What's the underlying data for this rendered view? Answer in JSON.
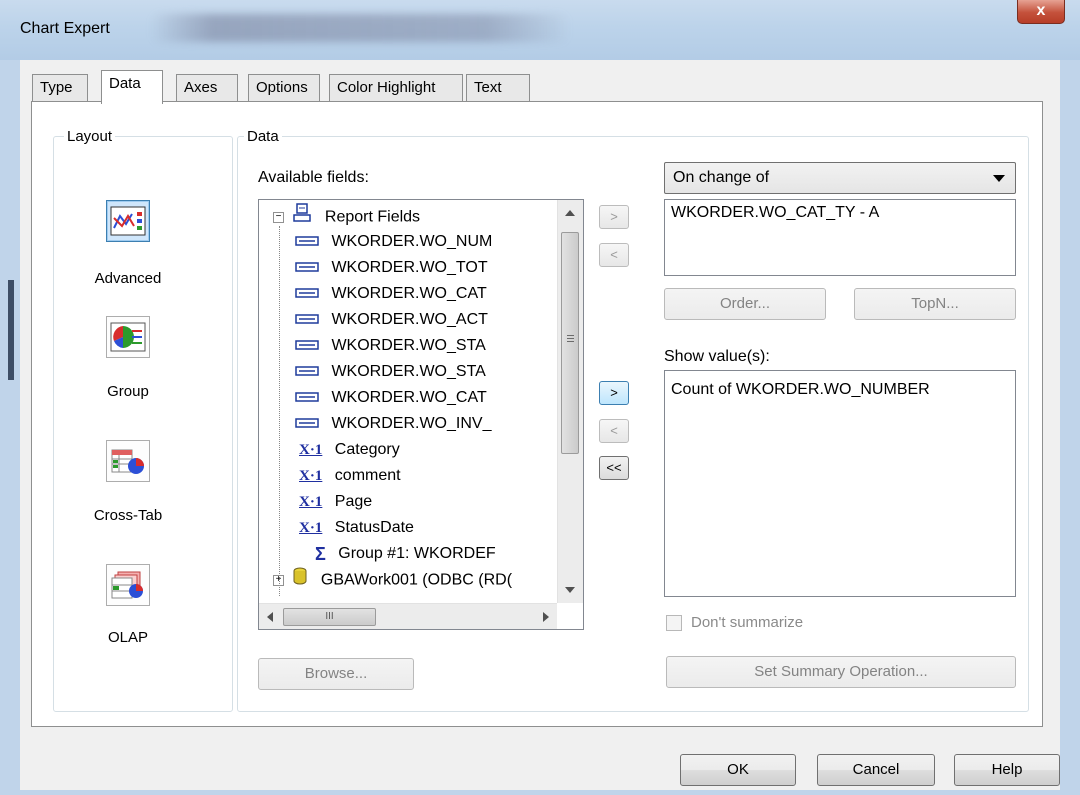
{
  "window": {
    "title": "Chart Expert",
    "close_glyph": "x"
  },
  "tabs": [
    {
      "label": "Type"
    },
    {
      "label": "Data"
    },
    {
      "label": "Axes"
    },
    {
      "label": "Options"
    },
    {
      "label": "Color Highlight"
    },
    {
      "label": "Text"
    }
  ],
  "active_tab": "Data",
  "layout_group": {
    "label": "Layout",
    "items": [
      {
        "label": "Advanced",
        "icon": "advanced-chart-icon",
        "selected": true
      },
      {
        "label": "Group",
        "icon": "group-chart-icon",
        "selected": false
      },
      {
        "label": "Cross-Tab",
        "icon": "crosstab-chart-icon",
        "selected": false
      },
      {
        "label": "OLAP",
        "icon": "olap-chart-icon",
        "selected": false
      }
    ]
  },
  "data_group": {
    "label": "Data",
    "available_fields_label": "Available fields:",
    "tree": [
      {
        "label": "Report Fields",
        "icon": "report-fields-icon",
        "expander": "minus"
      },
      {
        "label": "WKORDER.WO_NUM",
        "icon": "database-field-icon"
      },
      {
        "label": "WKORDER.WO_TOT",
        "icon": "database-field-icon"
      },
      {
        "label": "WKORDER.WO_CAT",
        "icon": "database-field-icon"
      },
      {
        "label": "WKORDER.WO_ACT",
        "icon": "database-field-icon"
      },
      {
        "label": "WKORDER.WO_STA",
        "icon": "database-field-icon"
      },
      {
        "label": "WKORDER.WO_STA",
        "icon": "database-field-icon"
      },
      {
        "label": "WKORDER.WO_CAT",
        "icon": "database-field-icon"
      },
      {
        "label": "WKORDER.WO_INV_",
        "icon": "database-field-icon"
      },
      {
        "label": "Category",
        "icon": "formula-field-icon"
      },
      {
        "label": "comment",
        "icon": "formula-field-icon"
      },
      {
        "label": "Page",
        "icon": "formula-field-icon"
      },
      {
        "label": "StatusDate",
        "icon": "formula-field-icon"
      },
      {
        "label": "Group #1: WKORDEF",
        "icon": "summary-sigma-icon"
      },
      {
        "label": "GBAWork001 (ODBC (RD(",
        "icon": "database-icon",
        "expander": "plus"
      }
    ],
    "hscroll_thumb_glyph": "III",
    "on_change_select": {
      "value": "On change of"
    },
    "on_change_fields": [
      "WKORDER.WO_CAT_TY - A"
    ],
    "order_button": "Order...",
    "topn_button": "TopN...",
    "show_values_label": "Show value(s):",
    "show_values": [
      "Count of WKORDER.WO_NUMBER"
    ],
    "dont_summarize_label": "Don't summarize",
    "dont_summarize_checked": false,
    "browse_button": "Browse...",
    "set_summary_button": "Set Summary Operation...",
    "arrow_buttons": {
      "add_group": ">",
      "remove_group": "<",
      "add_value": ">",
      "remove_value": "<",
      "remove_all": "<<"
    }
  },
  "footer": {
    "ok": "OK",
    "cancel": "Cancel",
    "help": "Help"
  }
}
